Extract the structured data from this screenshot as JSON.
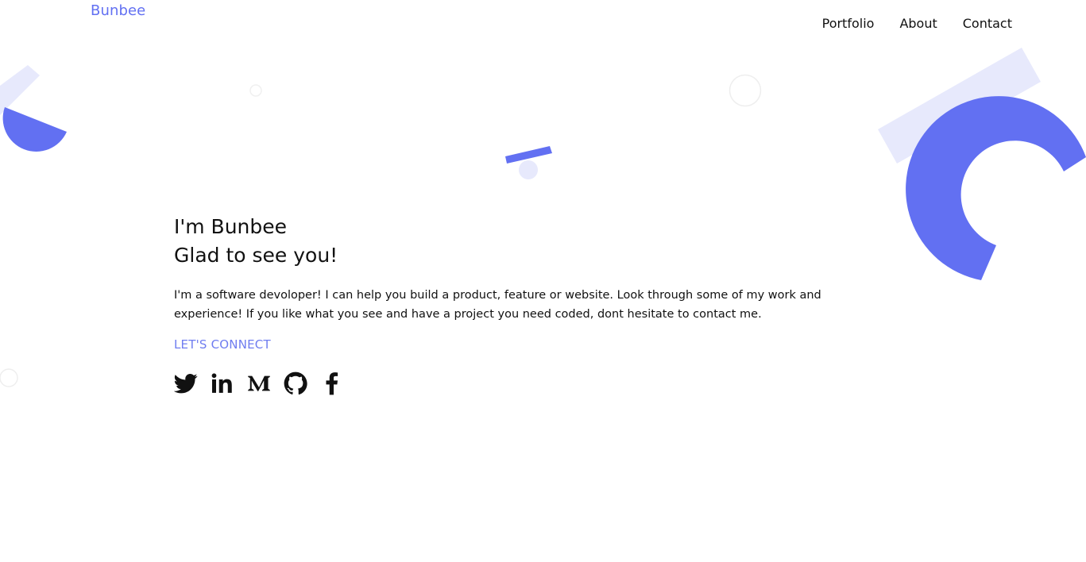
{
  "header": {
    "logo": "Bunbee",
    "nav": [
      {
        "label": "Portfolio"
      },
      {
        "label": "About"
      },
      {
        "label": "Contact"
      }
    ]
  },
  "hero": {
    "title_line1": "I'm Bunbee",
    "title_line2": "Glad to see you!",
    "description": "I'm a software devoloper! I can help you build a product, feature or website. Look through some of my work and experience! If you like what you see and have a project you need coded, dont hesitate to contact me.",
    "cta": "LET'S CONNECT"
  },
  "social": [
    {
      "icon": "twitter-icon"
    },
    {
      "icon": "linkedin-icon"
    },
    {
      "icon": "medium-icon"
    },
    {
      "icon": "github-icon"
    },
    {
      "icon": "facebook-icon"
    }
  ],
  "colors": {
    "accent": "#6270f2",
    "accent_light": "#e7e9fc",
    "text": "#111111"
  }
}
